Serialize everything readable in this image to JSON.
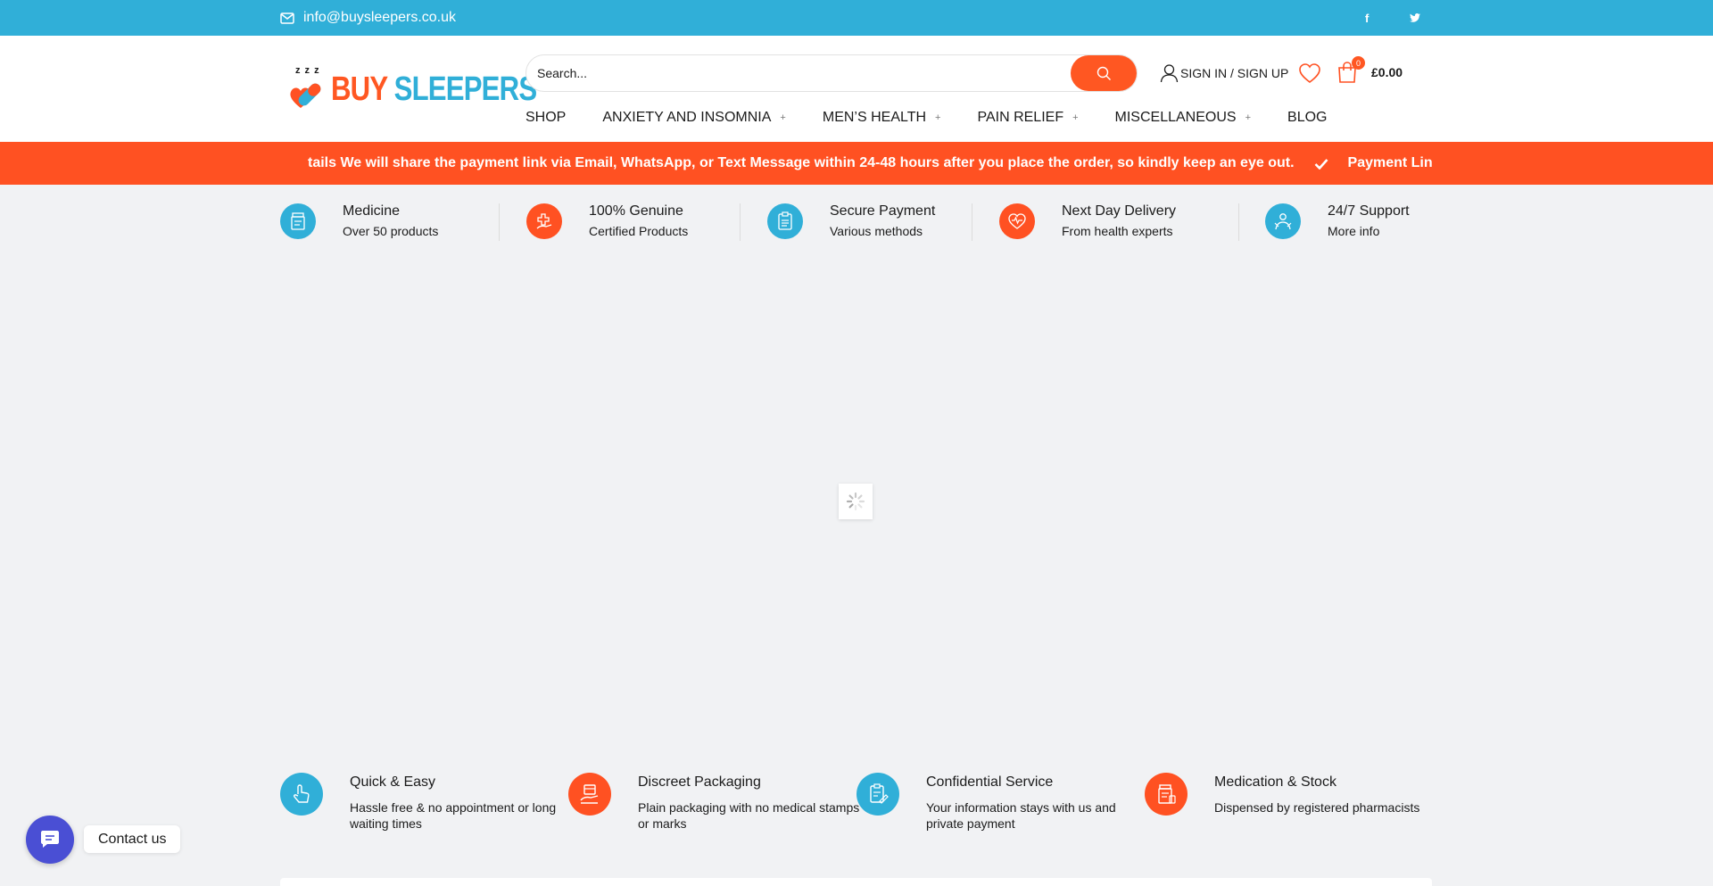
{
  "topbar": {
    "email": "info@buysleepers.co.uk",
    "social": [
      {
        "icon": "facebook-icon",
        "glyph": "f"
      },
      {
        "icon": "twitter-icon",
        "glyph": "t"
      }
    ]
  },
  "logo": {
    "zzz": "z z z",
    "buy": "BUY",
    "sleepers": "SLEEPERS"
  },
  "search": {
    "placeholder": "Search..."
  },
  "account": {
    "label": "SIGN IN / SIGN UP"
  },
  "cart": {
    "count": "0",
    "total": "£0.00"
  },
  "nav": [
    {
      "label": "SHOP",
      "has_sub": false
    },
    {
      "label": "ANXIETY AND INSOMNIA",
      "has_sub": true
    },
    {
      "label": "MEN’S HEALTH",
      "has_sub": true
    },
    {
      "label": "PAIN RELIEF",
      "has_sub": true
    },
    {
      "label": "MISCELLANEOUS",
      "has_sub": true
    },
    {
      "label": "BLOG",
      "has_sub": false
    }
  ],
  "nav_plus": "+",
  "ticker": {
    "text1": "tails We will share the payment link via Email, WhatsApp, or Text Message within 24-48 hours after you place the order, so kindly keep an eye out.",
    "text2": "Payment Link Details We"
  },
  "features": [
    {
      "title": "Medicine",
      "subtitle": "Over 50 products",
      "color": "#30afd8",
      "icon": "medicine-bottle-icon"
    },
    {
      "title": "100% Genuine",
      "subtitle": "Certified Products",
      "color": "#ff5122",
      "icon": "medical-hand-icon"
    },
    {
      "title": "Secure Payment",
      "subtitle": "Various methods",
      "color": "#30afd8",
      "icon": "clipboard-icon"
    },
    {
      "title": "Next Day Delivery",
      "subtitle": "From health experts",
      "color": "#ff5122",
      "icon": "heart-pulse-icon"
    },
    {
      "title": "24/7 Support",
      "subtitle": "More info",
      "color": "#30afd8",
      "icon": "support-icon"
    }
  ],
  "bottom_features": [
    {
      "title": "Quick & Easy",
      "desc": "Hassle free & no appointment or long waiting times",
      "color": "#30afd8",
      "icon": "hand-pointer-icon"
    },
    {
      "title": "Discreet Packaging",
      "desc": "Plain packaging with no medical stamps or marks",
      "color": "#ff5122",
      "icon": "package-hand-icon"
    },
    {
      "title": "Confidential Service",
      "desc": "Your information stays with us and private payment",
      "color": "#30afd8",
      "icon": "confidential-clipboard-icon"
    },
    {
      "title": "Medication & Stock",
      "desc": "Dispensed by registered pharmacists",
      "color": "#ff5122",
      "icon": "medication-bottle-icon"
    }
  ],
  "contact": {
    "label": "Contact us"
  },
  "colors": {
    "brand_blue": "#30afd8",
    "brand_orange": "#ff5122",
    "contact_purple": "#4a4fd4"
  }
}
